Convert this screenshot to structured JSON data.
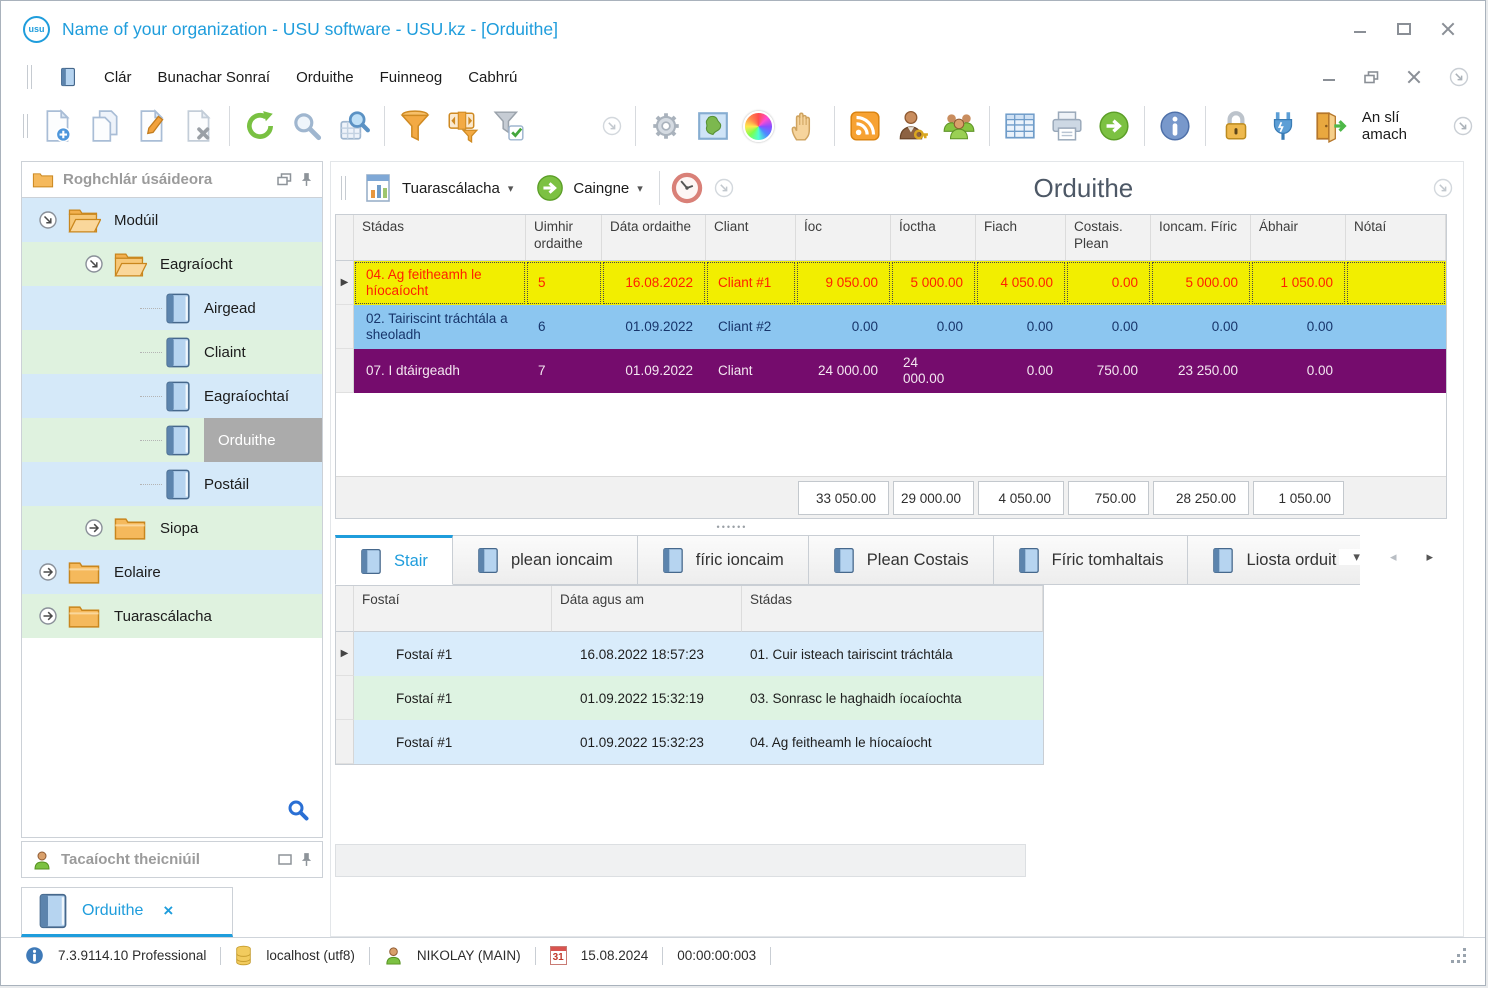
{
  "window": {
    "title": "Name of your organization - USU software - USU.kz - [Orduithe]",
    "logo_text": "usu"
  },
  "menu": {
    "items": [
      "Clár",
      "Bunachar Sonraí",
      "Orduithe",
      "Fuinneog",
      "Cabhrú"
    ]
  },
  "toolbar": {
    "exit_label": "An slí amach"
  },
  "sidebar": {
    "title": "Roghchlár úsáideora",
    "support_title": "Tacaíocht theicniúil",
    "tree": [
      {
        "label": "Modúil",
        "level": 0,
        "icon": "folder-open",
        "expand": "expanded"
      },
      {
        "label": "Eagraíocht",
        "level": 1,
        "icon": "folder-open",
        "expand": "expanded"
      },
      {
        "label": "Airgead",
        "level": 2,
        "icon": "book"
      },
      {
        "label": "Cliaint",
        "level": 2,
        "icon": "book"
      },
      {
        "label": "Eagraíochtaí",
        "level": 2,
        "icon": "book"
      },
      {
        "label": "Orduithe",
        "level": 2,
        "icon": "book",
        "selected": true
      },
      {
        "label": "Postáil",
        "level": 2,
        "icon": "book"
      },
      {
        "label": "Siopa",
        "level": 1,
        "icon": "folder",
        "expand": "collapsed"
      },
      {
        "label": "Eolaire",
        "level": 0,
        "icon": "folder",
        "expand": "collapsed"
      },
      {
        "label": "Tuarascálacha",
        "level": 0,
        "icon": "folder",
        "expand": "collapsed"
      }
    ]
  },
  "doc_tab": {
    "label": "Orduithe"
  },
  "main": {
    "reports_button": "Tuarascálacha",
    "actions_button": "Caingne",
    "title": "Orduithe",
    "table": {
      "columns": [
        "Stádas",
        "Uimhir ordaithe",
        "Dáta ordaithe",
        "Cliant",
        "Íoc",
        "Íoctha",
        "Fiach",
        "Costais. Plean",
        "Ioncam. Fíric",
        "Ábhair",
        "Nótaí"
      ],
      "rows": [
        {
          "status": "04. Ag feitheamh le híocaíocht",
          "number": "5",
          "date": "16.08.2022",
          "client": "Cliant #1",
          "ioc": "9 050.00",
          "ioctha": "5 000.00",
          "fiach": "4 050.00",
          "costais": "0.00",
          "ioncam": "5 000.00",
          "abhair": "1 050.00",
          "notai": ""
        },
        {
          "status": "02. Tairiscint tráchtála a sheoladh",
          "number": "6",
          "date": "01.09.2022",
          "client": "Cliant #2",
          "ioc": "0.00",
          "ioctha": "0.00",
          "fiach": "0.00",
          "costais": "0.00",
          "ioncam": "0.00",
          "abhair": "0.00",
          "notai": ""
        },
        {
          "status": "07. I dtáirgeadh",
          "number": "7",
          "date": "01.09.2022",
          "client": "Cliant",
          "ioc": "24 000.00",
          "ioctha": "24 000.00",
          "fiach": "0.00",
          "costais": "750.00",
          "ioncam": "23 250.00",
          "abhair": "0.00",
          "notai": ""
        }
      ],
      "totals": [
        "33 050.00",
        "29 000.00",
        "4 050.00",
        "750.00",
        "28 250.00",
        "1 050.00"
      ]
    },
    "tabs": [
      "Stair",
      "plean ioncaim",
      "fíric ioncaim",
      "Plean Costais",
      "Fíric tomhaltais",
      "Liosta orduit"
    ],
    "history": {
      "columns": [
        "Fostaí",
        "Dáta agus am",
        "Stádas"
      ],
      "rows": [
        {
          "employee": "Fostaí #1",
          "datetime": "16.08.2022 18:57:23",
          "status": "01. Cuir isteach tairiscint tráchtála"
        },
        {
          "employee": "Fostaí #1",
          "datetime": "01.09.2022 15:32:19",
          "status": "03. Sonrasc le haghaidh íocaíochta"
        },
        {
          "employee": "Fostaí #1",
          "datetime": "01.09.2022 15:32:23",
          "status": "04. Ag feitheamh le híocaíocht"
        }
      ]
    }
  },
  "statusbar": {
    "version": "7.3.9114.10 Professional",
    "host": "localhost (utf8)",
    "user": "NIKOLAY (MAIN)",
    "date": "15.08.2024",
    "calendar_day": "31",
    "timer": "00:00:00:003"
  },
  "icons": {
    "dropdown_arrow": "▾",
    "row_marker": "▶",
    "tab_menu": "▾",
    "tab_prev": "◂",
    "tab_next": "▸"
  },
  "colors": {
    "accent": "#1f9ddc",
    "row_yellow_bg": "#f2ee00",
    "row_yellow_text": "#ff2000",
    "row_blue_bg": "#8cc6f0",
    "row_blue_text": "#17356b",
    "row_purple_bg": "#750c6d",
    "row_purple_text": "#f4e7f1",
    "stripe_blue": "#d5e9f9",
    "stripe_green": "#dff2df",
    "selection_grey": "#ababab"
  }
}
